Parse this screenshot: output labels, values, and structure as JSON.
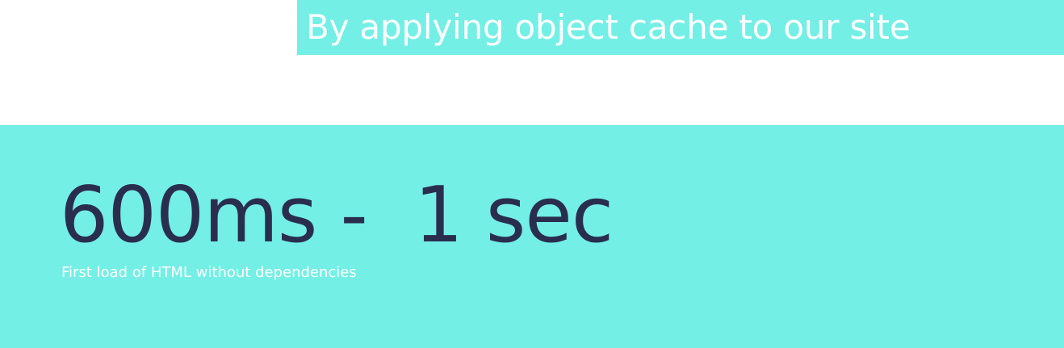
{
  "header": {
    "title": "By applying object cache to our site"
  },
  "main": {
    "metric": "600ms -  1 sec",
    "caption": "First load of HTML without dependencies"
  },
  "colors": {
    "accent": "#73efe6",
    "metric_text": "#2a2e4e",
    "light_text": "#ffffff",
    "background": "#ffffff"
  }
}
